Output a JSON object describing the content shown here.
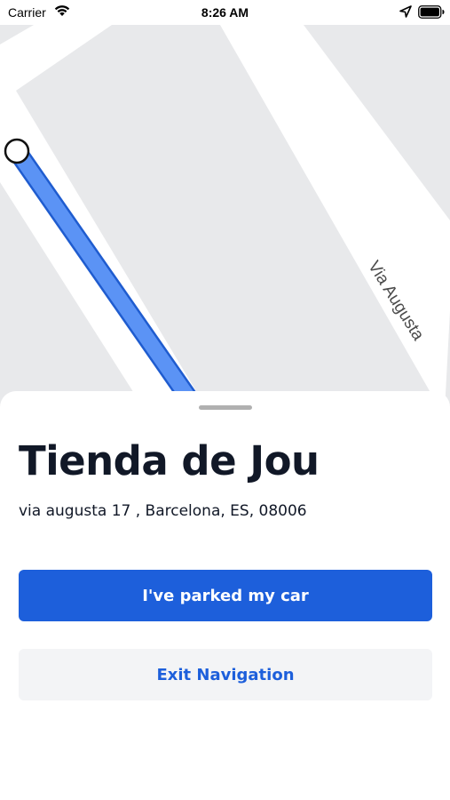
{
  "status_bar": {
    "carrier": "Carrier",
    "time": "8:26 AM",
    "icons": [
      "wifi-icon",
      "location-arrow-icon",
      "battery-icon"
    ]
  },
  "map": {
    "street_label": "Via Augusta",
    "colors": {
      "block": "#e8e9eb",
      "road": "#ffffff",
      "route": "#5b93f5",
      "route_outline": "#1f5ccf"
    }
  },
  "place": {
    "title": "Tienda de Jou",
    "address": "via augusta 17 , Barcelona, ES, 08006"
  },
  "actions": {
    "parked_label": "I've parked my car",
    "exit_label": "Exit Navigation"
  },
  "colors": {
    "primary": "#1d5fdb",
    "secondary_bg": "#f3f4f6",
    "text": "#111827"
  }
}
